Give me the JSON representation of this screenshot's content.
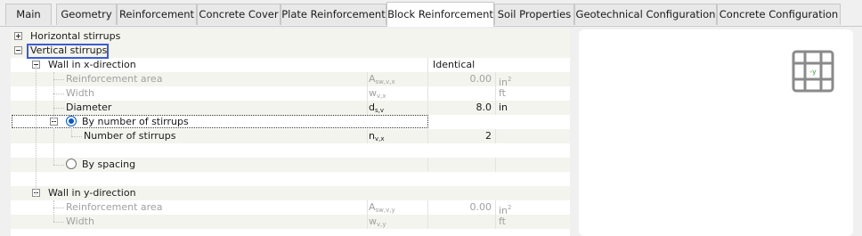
{
  "tabs": [
    {
      "label": "Main"
    },
    {
      "label": "Geometry"
    },
    {
      "label": "Reinforcement"
    },
    {
      "label": "Concrete Cover"
    },
    {
      "label": "Plate Reinforcement"
    },
    {
      "label": "Block Reinforcement",
      "active": true
    },
    {
      "label": "Soil Properties"
    },
    {
      "label": "Geotechnical Configuration"
    },
    {
      "label": "Concrete Configuration"
    }
  ],
  "tree": {
    "horizontal_stirrups": "Horizontal stirrups",
    "vertical_stirrups": "Vertical stirrups",
    "wall_x": {
      "label": "Wall in x-direction",
      "option": "Identical",
      "reinforcement_area": {
        "label": "Reinforcement area",
        "symbol": "A",
        "symbol_sub": "sw,v,x",
        "value": "0.00",
        "unit": "in",
        "unit_sup": "2"
      },
      "width": {
        "label": "Width",
        "symbol": "w",
        "symbol_sub": "v,x",
        "value": "",
        "unit": "ft"
      },
      "diameter": {
        "label": "Diameter",
        "symbol": "d",
        "symbol_sub": "s,v",
        "value": "8.0",
        "unit": "in"
      },
      "by_number": {
        "label": "By number of stirrups"
      },
      "number_of_stirrups": {
        "label": "Number of stirrups",
        "symbol": "n",
        "symbol_sub": "v,x",
        "value": "2"
      },
      "by_spacing": {
        "label": "By spacing"
      }
    },
    "wall_y": {
      "label": "Wall in y-direction",
      "reinforcement_area": {
        "label": "Reinforcement area",
        "symbol": "A",
        "symbol_sub": "sw,v,y",
        "value": "0.00",
        "unit": "in",
        "unit_sup": "2"
      },
      "width": {
        "label": "Width",
        "symbol": "w",
        "symbol_sub": "v,y",
        "value": "",
        "unit": "ft"
      }
    }
  },
  "preview": {
    "icon": "block-stirrup-grid-icon",
    "axis_label": "-y",
    "axis_color": "#3aa33a"
  },
  "colors": {
    "selection_border": "#3d5bd4",
    "radio_selected": "#0a58c2",
    "disabled_text": "#a0a0a0"
  }
}
